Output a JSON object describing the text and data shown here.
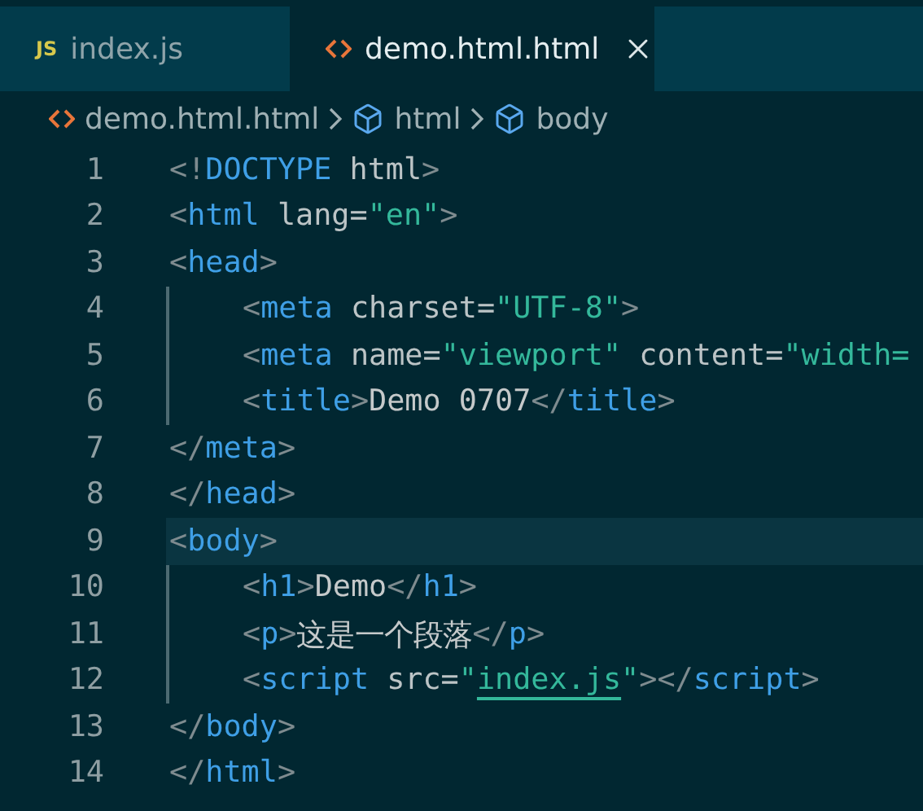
{
  "tabs": [
    {
      "label": "index.js",
      "kind": "js",
      "icon_text": "JS",
      "selected": false
    },
    {
      "label": "demo.html.html",
      "kind": "html",
      "selected": true
    }
  ],
  "breadcrumbs": [
    {
      "label": "demo.html.html",
      "kind": "html"
    },
    {
      "label": "html",
      "kind": "element"
    },
    {
      "label": "body",
      "kind": "element"
    }
  ],
  "code": [
    {
      "number": "1",
      "current": false,
      "tokens": [
        {
          "kind": "punct",
          "text": "<!"
        },
        {
          "kind": "tag",
          "text": "DOCTYPE"
        },
        {
          "kind": "attr",
          "text": " html"
        },
        {
          "kind": "punct",
          "text": ">"
        }
      ]
    },
    {
      "number": "2",
      "current": false,
      "tokens": [
        {
          "kind": "punct",
          "text": "<"
        },
        {
          "kind": "tag",
          "text": "html"
        },
        {
          "kind": "attr",
          "text": " lang="
        },
        {
          "kind": "string",
          "text": "\"en\""
        },
        {
          "kind": "punct",
          "text": ">"
        }
      ]
    },
    {
      "number": "3",
      "current": false,
      "tokens": [
        {
          "kind": "punct",
          "text": "<"
        },
        {
          "kind": "tag",
          "text": "head"
        },
        {
          "kind": "punct",
          "text": ">"
        }
      ],
      "children": [
        {
          "number": "4",
          "current": false,
          "tokens": [
            {
              "kind": "punct",
              "text": "<"
            },
            {
              "kind": "tag",
              "text": "meta"
            },
            {
              "kind": "attr",
              "text": " charset="
            },
            {
              "kind": "string",
              "text": "\"UTF-8\""
            },
            {
              "kind": "punct",
              "text": ">"
            }
          ]
        },
        {
          "number": "5",
          "current": false,
          "tokens": [
            {
              "kind": "punct",
              "text": "<"
            },
            {
              "kind": "tag",
              "text": "meta"
            },
            {
              "kind": "attr",
              "text": " name="
            },
            {
              "kind": "string",
              "text": "\"viewport\""
            },
            {
              "kind": "attr",
              "text": " content="
            },
            {
              "kind": "string",
              "text": "\"width="
            }
          ]
        },
        {
          "number": "6",
          "current": false,
          "tokens": [
            {
              "kind": "punct",
              "text": "<"
            },
            {
              "kind": "tag",
              "text": "title"
            },
            {
              "kind": "punct",
              "text": ">"
            },
            {
              "kind": "text",
              "text": "Demo 0707"
            },
            {
              "kind": "punct",
              "text": "</"
            },
            {
              "kind": "tag",
              "text": "title"
            },
            {
              "kind": "punct",
              "text": ">"
            }
          ]
        }
      ]
    },
    {
      "number": "7",
      "current": false,
      "tokens": [
        {
          "kind": "punct",
          "text": "</"
        },
        {
          "kind": "tag",
          "text": "meta"
        },
        {
          "kind": "punct",
          "text": ">"
        }
      ]
    },
    {
      "number": "8",
      "current": false,
      "tokens": [
        {
          "kind": "punct",
          "text": "</"
        },
        {
          "kind": "tag",
          "text": "head"
        },
        {
          "kind": "punct",
          "text": ">"
        }
      ]
    },
    {
      "number": "9",
      "current": true,
      "tokens": [
        {
          "kind": "punct",
          "text": "<"
        },
        {
          "kind": "tag",
          "text": "body"
        },
        {
          "kind": "punct",
          "text": ">"
        }
      ],
      "children": [
        {
          "number": "10",
          "current": false,
          "tokens": [
            {
              "kind": "punct",
              "text": "<"
            },
            {
              "kind": "tag",
              "text": "h1"
            },
            {
              "kind": "punct",
              "text": ">"
            },
            {
              "kind": "text",
              "text": "Demo"
            },
            {
              "kind": "punct",
              "text": "</"
            },
            {
              "kind": "tag",
              "text": "h1"
            },
            {
              "kind": "punct",
              "text": ">"
            }
          ]
        },
        {
          "number": "11",
          "current": false,
          "tokens": [
            {
              "kind": "punct",
              "text": "<"
            },
            {
              "kind": "tag",
              "text": "p"
            },
            {
              "kind": "punct",
              "text": ">"
            },
            {
              "kind": "text",
              "text": "这是一个段落"
            },
            {
              "kind": "punct",
              "text": "</"
            },
            {
              "kind": "tag",
              "text": "p"
            },
            {
              "kind": "punct",
              "text": ">"
            }
          ]
        },
        {
          "number": "12",
          "current": false,
          "tokens": [
            {
              "kind": "punct",
              "text": "<"
            },
            {
              "kind": "tag",
              "text": "script"
            },
            {
              "kind": "attr",
              "text": " src="
            },
            {
              "kind": "string",
              "text": "\""
            },
            {
              "kind": "link",
              "text": "index.js"
            },
            {
              "kind": "string",
              "text": "\""
            },
            {
              "kind": "punct",
              "text": "></"
            },
            {
              "kind": "tag",
              "text": "script"
            },
            {
              "kind": "punct",
              "text": ">"
            }
          ]
        }
      ]
    },
    {
      "number": "13",
      "current": false,
      "tokens": [
        {
          "kind": "punct",
          "text": "</"
        },
        {
          "kind": "tag",
          "text": "body"
        },
        {
          "kind": "punct",
          "text": ">"
        }
      ]
    },
    {
      "number": "14",
      "current": false,
      "tokens": [
        {
          "kind": "punct",
          "text": "</"
        },
        {
          "kind": "tag",
          "text": "html"
        },
        {
          "kind": "punct",
          "text": ">"
        }
      ]
    }
  ]
}
